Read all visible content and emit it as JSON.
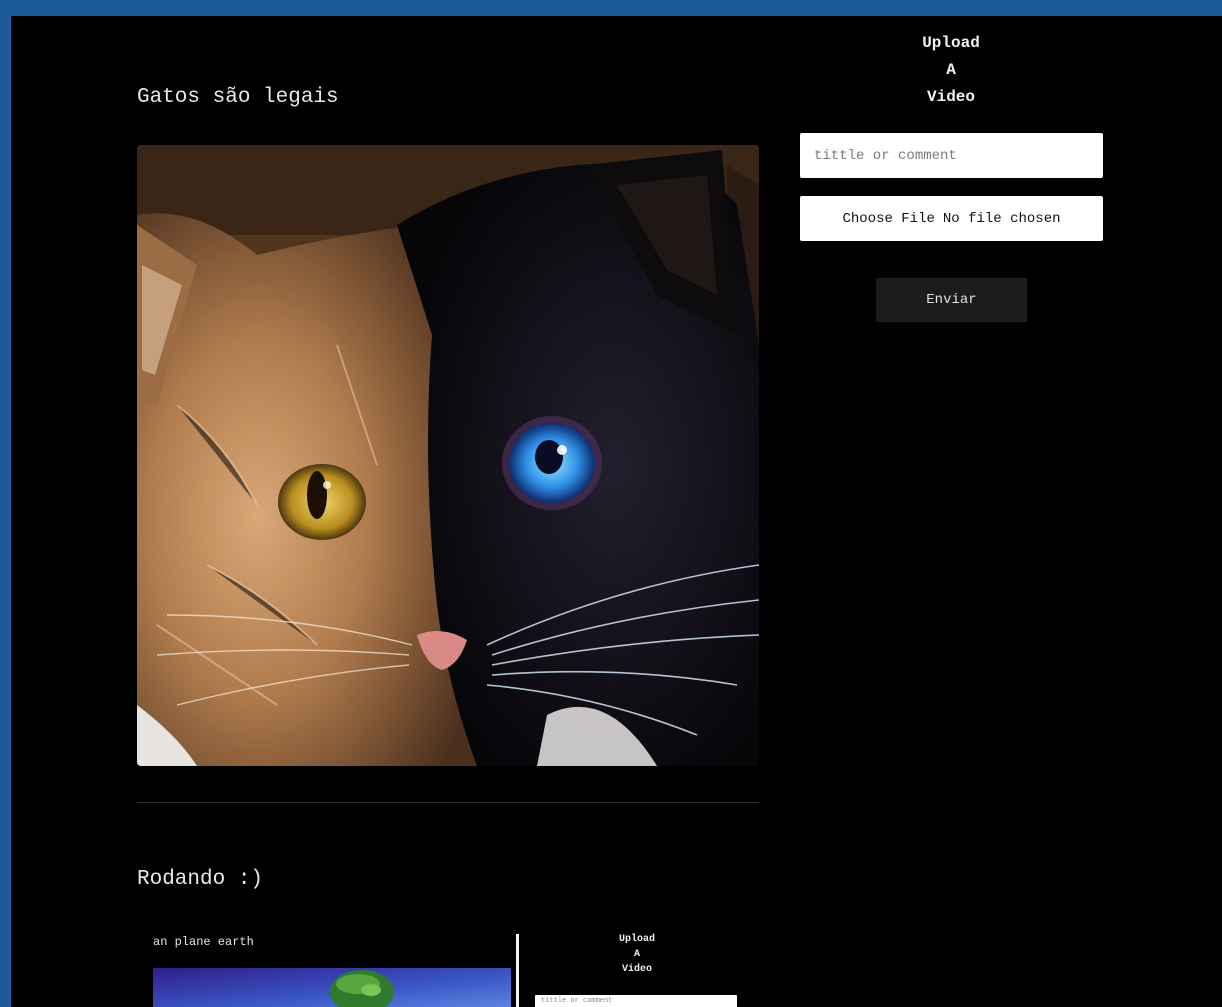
{
  "posts": [
    {
      "title": "Gatos são legais"
    },
    {
      "title": "Rodando :)",
      "preview": {
        "caption": "an plane earth",
        "upload_heading": [
          "Upload",
          "A",
          "Video"
        ],
        "title_placeholder": "tittle or comment"
      }
    }
  ],
  "upload": {
    "heading": [
      "Upload",
      "A",
      "Video"
    ],
    "title_placeholder": "tittle or comment",
    "file_button_label": "Choose File",
    "file_status": "No file chosen",
    "submit_label": "Enviar"
  },
  "colors": {
    "frame": "#1c5a9a",
    "background": "#000000",
    "input_bg": "#ffffff",
    "button_bg": "#1c1c1c"
  }
}
